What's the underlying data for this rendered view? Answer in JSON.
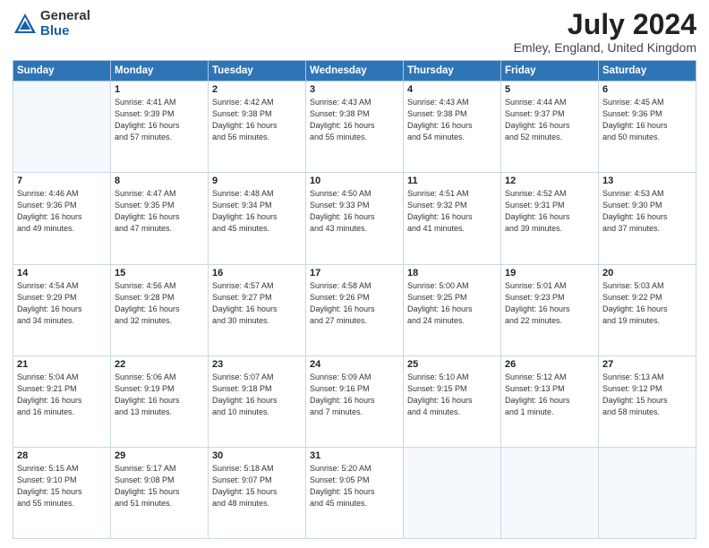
{
  "header": {
    "logo_general": "General",
    "logo_blue": "Blue",
    "month_title": "July 2024",
    "location": "Emley, England, United Kingdom"
  },
  "calendar": {
    "weekdays": [
      "Sunday",
      "Monday",
      "Tuesday",
      "Wednesday",
      "Thursday",
      "Friday",
      "Saturday"
    ],
    "weeks": [
      [
        {
          "day": "",
          "info": ""
        },
        {
          "day": "1",
          "info": "Sunrise: 4:41 AM\nSunset: 9:39 PM\nDaylight: 16 hours\nand 57 minutes."
        },
        {
          "day": "2",
          "info": "Sunrise: 4:42 AM\nSunset: 9:38 PM\nDaylight: 16 hours\nand 56 minutes."
        },
        {
          "day": "3",
          "info": "Sunrise: 4:43 AM\nSunset: 9:38 PM\nDaylight: 16 hours\nand 55 minutes."
        },
        {
          "day": "4",
          "info": "Sunrise: 4:43 AM\nSunset: 9:38 PM\nDaylight: 16 hours\nand 54 minutes."
        },
        {
          "day": "5",
          "info": "Sunrise: 4:44 AM\nSunset: 9:37 PM\nDaylight: 16 hours\nand 52 minutes."
        },
        {
          "day": "6",
          "info": "Sunrise: 4:45 AM\nSunset: 9:36 PM\nDaylight: 16 hours\nand 50 minutes."
        }
      ],
      [
        {
          "day": "7",
          "info": "Sunrise: 4:46 AM\nSunset: 9:36 PM\nDaylight: 16 hours\nand 49 minutes."
        },
        {
          "day": "8",
          "info": "Sunrise: 4:47 AM\nSunset: 9:35 PM\nDaylight: 16 hours\nand 47 minutes."
        },
        {
          "day": "9",
          "info": "Sunrise: 4:48 AM\nSunset: 9:34 PM\nDaylight: 16 hours\nand 45 minutes."
        },
        {
          "day": "10",
          "info": "Sunrise: 4:50 AM\nSunset: 9:33 PM\nDaylight: 16 hours\nand 43 minutes."
        },
        {
          "day": "11",
          "info": "Sunrise: 4:51 AM\nSunset: 9:32 PM\nDaylight: 16 hours\nand 41 minutes."
        },
        {
          "day": "12",
          "info": "Sunrise: 4:52 AM\nSunset: 9:31 PM\nDaylight: 16 hours\nand 39 minutes."
        },
        {
          "day": "13",
          "info": "Sunrise: 4:53 AM\nSunset: 9:30 PM\nDaylight: 16 hours\nand 37 minutes."
        }
      ],
      [
        {
          "day": "14",
          "info": "Sunrise: 4:54 AM\nSunset: 9:29 PM\nDaylight: 16 hours\nand 34 minutes."
        },
        {
          "day": "15",
          "info": "Sunrise: 4:56 AM\nSunset: 9:28 PM\nDaylight: 16 hours\nand 32 minutes."
        },
        {
          "day": "16",
          "info": "Sunrise: 4:57 AM\nSunset: 9:27 PM\nDaylight: 16 hours\nand 30 minutes."
        },
        {
          "day": "17",
          "info": "Sunrise: 4:58 AM\nSunset: 9:26 PM\nDaylight: 16 hours\nand 27 minutes."
        },
        {
          "day": "18",
          "info": "Sunrise: 5:00 AM\nSunset: 9:25 PM\nDaylight: 16 hours\nand 24 minutes."
        },
        {
          "day": "19",
          "info": "Sunrise: 5:01 AM\nSunset: 9:23 PM\nDaylight: 16 hours\nand 22 minutes."
        },
        {
          "day": "20",
          "info": "Sunrise: 5:03 AM\nSunset: 9:22 PM\nDaylight: 16 hours\nand 19 minutes."
        }
      ],
      [
        {
          "day": "21",
          "info": "Sunrise: 5:04 AM\nSunset: 9:21 PM\nDaylight: 16 hours\nand 16 minutes."
        },
        {
          "day": "22",
          "info": "Sunrise: 5:06 AM\nSunset: 9:19 PM\nDaylight: 16 hours\nand 13 minutes."
        },
        {
          "day": "23",
          "info": "Sunrise: 5:07 AM\nSunset: 9:18 PM\nDaylight: 16 hours\nand 10 minutes."
        },
        {
          "day": "24",
          "info": "Sunrise: 5:09 AM\nSunset: 9:16 PM\nDaylight: 16 hours\nand 7 minutes."
        },
        {
          "day": "25",
          "info": "Sunrise: 5:10 AM\nSunset: 9:15 PM\nDaylight: 16 hours\nand 4 minutes."
        },
        {
          "day": "26",
          "info": "Sunrise: 5:12 AM\nSunset: 9:13 PM\nDaylight: 16 hours\nand 1 minute."
        },
        {
          "day": "27",
          "info": "Sunrise: 5:13 AM\nSunset: 9:12 PM\nDaylight: 15 hours\nand 58 minutes."
        }
      ],
      [
        {
          "day": "28",
          "info": "Sunrise: 5:15 AM\nSunset: 9:10 PM\nDaylight: 15 hours\nand 55 minutes."
        },
        {
          "day": "29",
          "info": "Sunrise: 5:17 AM\nSunset: 9:08 PM\nDaylight: 15 hours\nand 51 minutes."
        },
        {
          "day": "30",
          "info": "Sunrise: 5:18 AM\nSunset: 9:07 PM\nDaylight: 15 hours\nand 48 minutes."
        },
        {
          "day": "31",
          "info": "Sunrise: 5:20 AM\nSunset: 9:05 PM\nDaylight: 15 hours\nand 45 minutes."
        },
        {
          "day": "",
          "info": ""
        },
        {
          "day": "",
          "info": ""
        },
        {
          "day": "",
          "info": ""
        }
      ]
    ]
  }
}
